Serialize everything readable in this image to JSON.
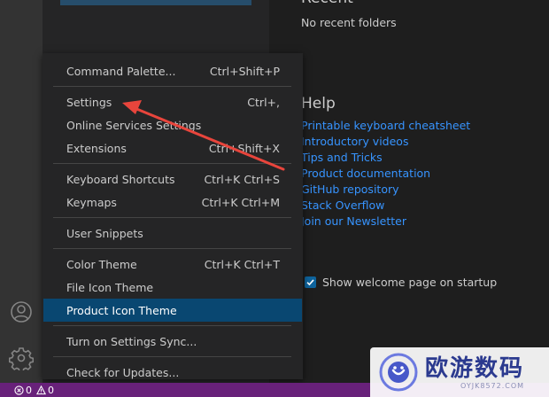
{
  "colors": {
    "accent": "#0e639c",
    "link": "#3794ff",
    "status_bar": "#68217a",
    "menu_highlight": "#094771",
    "annotation_arrow": "#e8453c"
  },
  "editor": {
    "recent_heading": "Recent",
    "no_recent": "No recent folders",
    "help_heading": "Help",
    "help_links": [
      "Printable keyboard cheatsheet",
      "Introductory videos",
      "Tips and Tricks",
      "Product documentation",
      "GitHub repository",
      "Stack Overflow",
      "Join our Newsletter"
    ],
    "startup_label": "Show welcome page on startup",
    "startup_checked": true
  },
  "menu": {
    "items": [
      {
        "label": "Command Palette...",
        "shortcut": "Ctrl+Shift+P"
      },
      {
        "label": "Settings",
        "shortcut": "Ctrl+,"
      },
      {
        "label": "Online Services Settings",
        "shortcut": ""
      },
      {
        "label": "Extensions",
        "shortcut": "Ctrl+Shift+X"
      },
      {
        "label": "Keyboard Shortcuts",
        "shortcut": "Ctrl+K Ctrl+S"
      },
      {
        "label": "Keymaps",
        "shortcut": "Ctrl+K Ctrl+M"
      },
      {
        "label": "User Snippets",
        "shortcut": ""
      },
      {
        "label": "Color Theme",
        "shortcut": "Ctrl+K Ctrl+T"
      },
      {
        "label": "File Icon Theme",
        "shortcut": ""
      },
      {
        "label": "Product Icon Theme",
        "shortcut": ""
      },
      {
        "label": "Turn on Settings Sync...",
        "shortcut": ""
      },
      {
        "label": "Check for Updates...",
        "shortcut": ""
      }
    ],
    "active_item": "Product Icon Theme"
  },
  "activity_bar": {
    "icons": [
      "account-icon",
      "manage-gear-icon"
    ]
  },
  "status_bar": {
    "errors": "0",
    "warnings": "0"
  },
  "watermark": {
    "brand": "欧游数码",
    "url": "OYJK8572.COM"
  }
}
